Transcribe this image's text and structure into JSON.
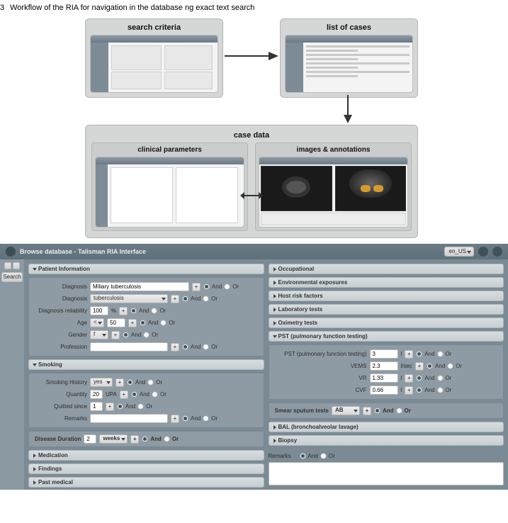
{
  "caption": {
    "num": "3",
    "text": "Workflow of the RIA for navigation in the database ng exact text search"
  },
  "workflow": {
    "search_label": "search criteria",
    "list_label": "list of cases",
    "case_label": "case data",
    "clinical_label": "clinical parameters",
    "images_label": "images & annotations"
  },
  "app": {
    "title": "Browse database - Talisman RIA Interface",
    "lang": "en_US",
    "search_btn": "Search",
    "radio": {
      "and": "And",
      "or": "Or"
    },
    "pct": "%",
    "ops": {
      "lt": "<",
      "plus": "+",
      "eq": "="
    },
    "left": {
      "patient_info_hd": "Patient Information",
      "diagnosis1_lbl": "Diagnosis",
      "diagnosis1_val": "Miliary tuberculosis",
      "diagnosis2_lbl": "Diagnosis",
      "diagnosis2_val": "tuberculosis",
      "diag_rel_lbl": "Diagnosis reliability",
      "diag_rel_val": "100",
      "age_lbl": "Age",
      "age_val": "50",
      "gender_lbl": "Gender",
      "gender_val": "f",
      "prof_lbl": "Profession",
      "smoking_hd": "Smoking",
      "smhist_lbl": "Smoking History",
      "smhist_val": "yes",
      "qty_lbl": "Quantity",
      "qty_val": "20",
      "qty_unit": "UPA",
      "quit_lbl": "Quitted since",
      "quit_val": "1",
      "remarks_lbl": "Remarks",
      "disease_dur_lbl": "Disease Duration",
      "disease_dur_val": "2",
      "disease_dur_unit": "weeks",
      "med_hd": "Medication",
      "find_hd": "Findings",
      "past_hd": "Past medical"
    },
    "right": {
      "occ_hd": "Occupational",
      "env_hd": "Environmental exposures",
      "hrf_hd": "Host risk factors",
      "lab_hd": "Laboratory tests",
      "oxi_hd": "Oximetry tests",
      "pst_hd": "PST (pulmonary function testing)",
      "pst_lbl": "PST (pulmonary function testing)",
      "pst_val": "3",
      "vems_lbl": "VEMS",
      "vems_val": "2.3",
      "vems_unit": "l/sec",
      "vr_lbl": "VR",
      "vr_val": "1.33",
      "cvf_lbl": "CVF",
      "cvf_val": "0.66",
      "l_unit": "l",
      "smear_lbl": "Smear sputum tests",
      "smear_val": "AB",
      "bal_hd": "BAL (bronchoalveolar lavage)",
      "biopsy_hd": "Biopsy",
      "remarks_lbl": "Remarks"
    }
  }
}
